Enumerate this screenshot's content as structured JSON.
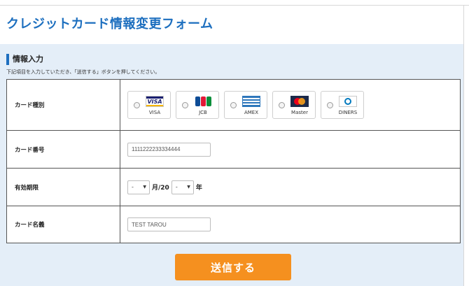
{
  "page": {
    "title": "クレジットカード情報変更フォーム"
  },
  "section": {
    "heading": "情報入力",
    "instructions": "下記項目を入力していただき、「送信する」ボタンを押してください。"
  },
  "form": {
    "card_type": {
      "label": "カード種別",
      "options": [
        {
          "label": "VISA",
          "icon": "visa-logo-icon"
        },
        {
          "label": "JCB",
          "icon": "jcb-logo-icon"
        },
        {
          "label": "AMEX",
          "icon": "amex-logo-icon"
        },
        {
          "label": "Master",
          "icon": "mastercard-logo-icon"
        },
        {
          "label": "DINERS",
          "icon": "diners-logo-icon"
        }
      ]
    },
    "card_number": {
      "label": "カード番号",
      "value": "1111222233334444"
    },
    "expiry": {
      "label": "有効期限",
      "month_value": "-",
      "month_suffix": "月/20",
      "year_value": "-",
      "year_suffix": "年"
    },
    "card_name": {
      "label": "カード名義",
      "value": "TEST TAROU"
    },
    "submit_label": "送信する"
  },
  "colors": {
    "title": "#1d6fbf",
    "form_background": "#e4eef8",
    "submit_button": "#f5901f"
  }
}
